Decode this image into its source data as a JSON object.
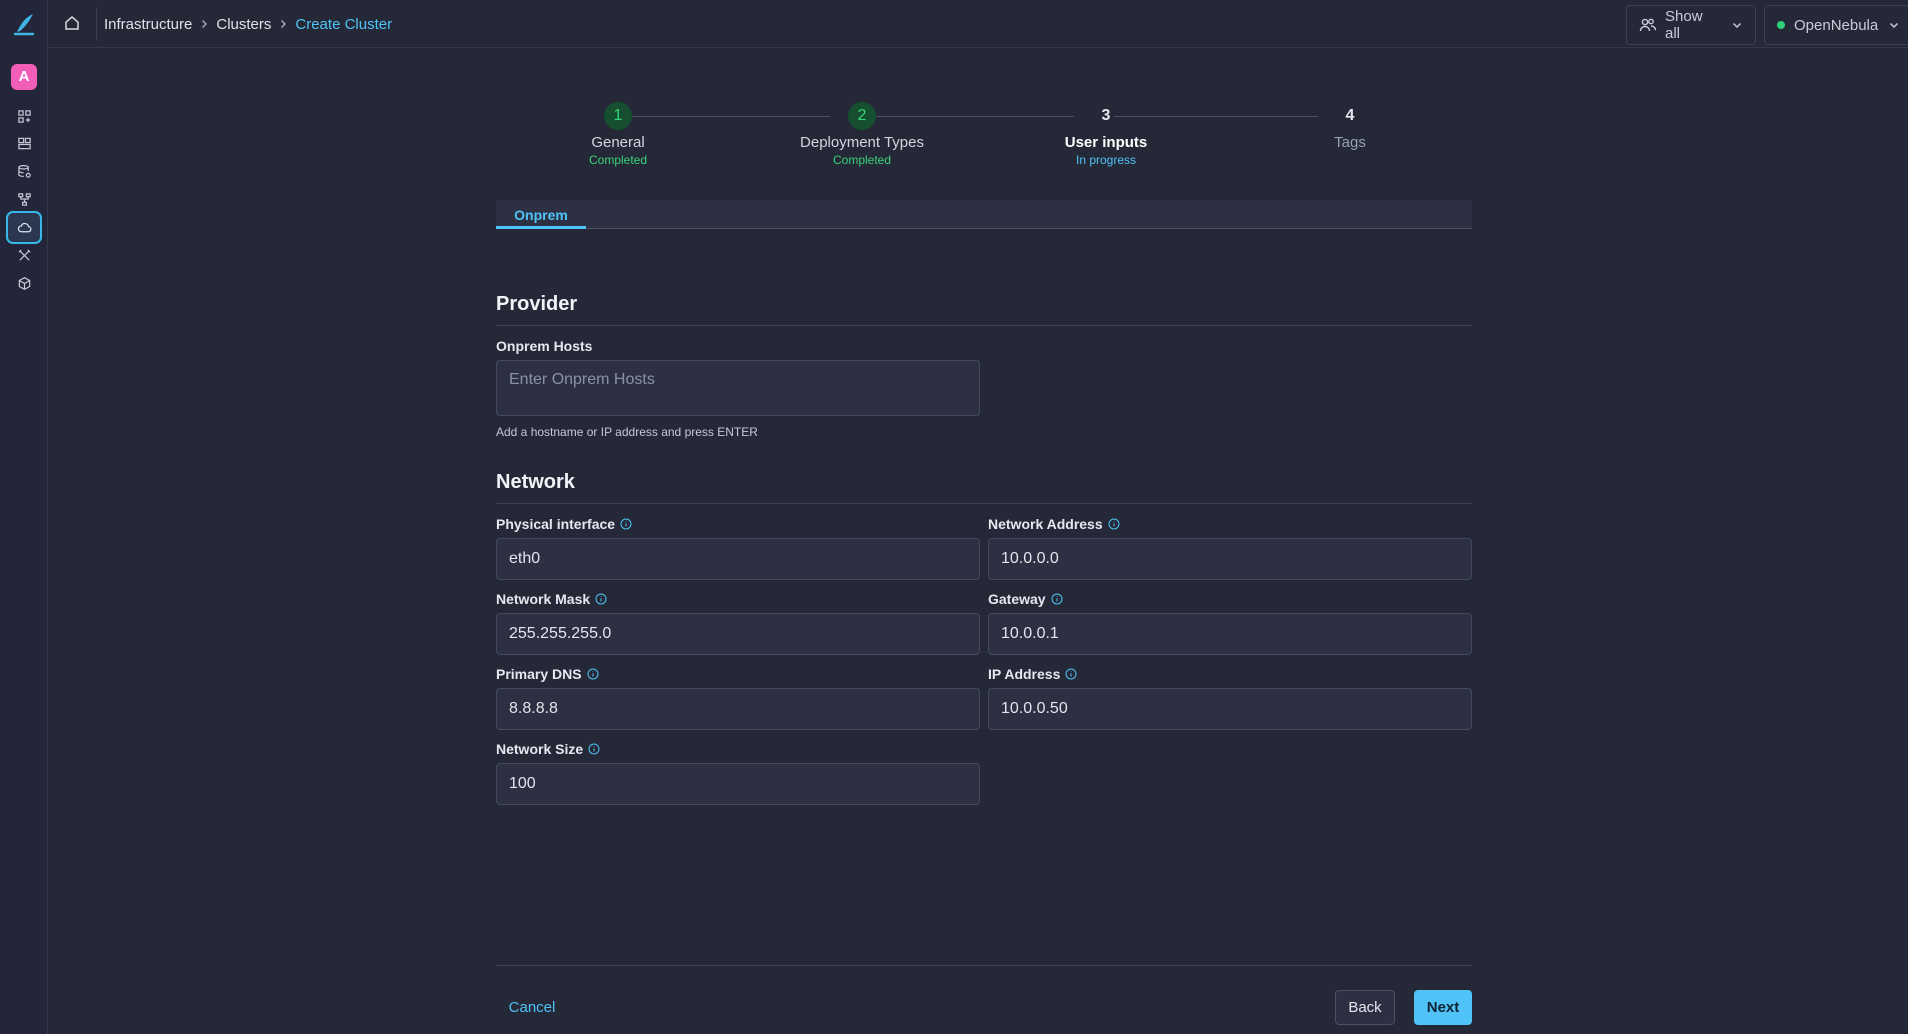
{
  "breadcrumb": [
    "Infrastructure",
    "Clusters",
    "Create Cluster"
  ],
  "topbar": {
    "show_all_label": "Show all",
    "zone_label": "OpenNebula"
  },
  "user": {
    "avatar_letter": "A"
  },
  "sidebar": {
    "icons": [
      "dashboard-icon",
      "instances-icon",
      "storage-icon",
      "network-icon",
      "cloud-icon",
      "tools-icon",
      "cube-icon"
    ],
    "active_icon": "cloud-icon"
  },
  "stepper": {
    "steps": [
      {
        "number": "1",
        "label": "General",
        "status": "Completed"
      },
      {
        "number": "2",
        "label": "Deployment Types",
        "status": "Completed"
      },
      {
        "number": "3",
        "label": "User inputs",
        "status": "In progress"
      },
      {
        "number": "4",
        "label": "Tags",
        "status": ""
      }
    ]
  },
  "tabs": [
    {
      "label": "Onprem",
      "active": true
    }
  ],
  "provider": {
    "title": "Provider",
    "onprem_hosts_label": "Onprem Hosts",
    "onprem_hosts_placeholder": "Enter Onprem Hosts",
    "onprem_hosts_helper": "Add a hostname or IP address and press ENTER"
  },
  "network": {
    "title": "Network",
    "physical_interface": {
      "label": "Physical interface",
      "value": "eth0"
    },
    "network_address": {
      "label": "Network Address",
      "value": "10.0.0.0"
    },
    "network_mask": {
      "label": "Network Mask",
      "value": "255.255.255.0"
    },
    "gateway": {
      "label": "Gateway",
      "value": "10.0.0.1"
    },
    "primary_dns": {
      "label": "Primary DNS",
      "value": "8.8.8.8"
    },
    "ip_address": {
      "label": "IP Address",
      "value": "10.0.0.50"
    },
    "network_size": {
      "label": "Network Size",
      "value": "100"
    }
  },
  "footer": {
    "cancel_label": "Cancel",
    "back_label": "Back",
    "next_label": "Next"
  },
  "colors": {
    "accent": "#4fc3f7",
    "success": "#39d37a",
    "background": "#252837",
    "avatar": "#f25db8"
  }
}
